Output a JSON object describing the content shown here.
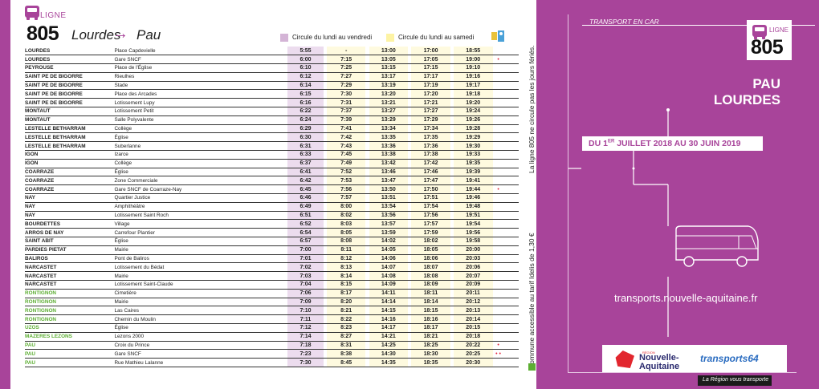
{
  "header": {
    "ligne_label": "LIGNE",
    "route_number": "805",
    "from": "Lourdes",
    "arrow": "→",
    "to": "Pau",
    "legend_friday": "Circule du lundi au vendredi",
    "legend_weekdays": "Circule du lundi au samedi",
    "colors": {
      "brand": "#a8449a",
      "friday": "#ecdcee",
      "weekdays": "#fefadf",
      "green": "#5cae32",
      "mark": "#e3243b"
    }
  },
  "timetable": {
    "rows": [
      {
        "city": "LOURDES",
        "stop": "Place Capdevielle",
        "t1": "5:55",
        "t2": "-",
        "t3": "13:00",
        "t4": "17:00",
        "t5": "18:55",
        "mark": "",
        "green": false
      },
      {
        "city": "LOURDES",
        "stop": "Gare SNCF",
        "t1": "6:00",
        "t2": "7:15",
        "t3": "13:05",
        "t4": "17:05",
        "t5": "19:00",
        "mark": "•",
        "green": false
      },
      {
        "city": "PEYROUSE",
        "stop": "Place de l'Église",
        "t1": "6:10",
        "t2": "7:25",
        "t3": "13:15",
        "t4": "17:15",
        "t5": "19:10",
        "mark": "",
        "green": false
      },
      {
        "city": "SAINT PE DE BIGORRE",
        "stop": "Rieulhes",
        "t1": "6:12",
        "t2": "7:27",
        "t3": "13:17",
        "t4": "17:17",
        "t5": "19:16",
        "mark": "",
        "green": false
      },
      {
        "city": "SAINT PE DE BIGORRE",
        "stop": "Stade",
        "t1": "6:14",
        "t2": "7:29",
        "t3": "13:19",
        "t4": "17:19",
        "t5": "19:17",
        "mark": "",
        "green": false
      },
      {
        "city": "SAINT PE DE BIGORRE",
        "stop": "Place des Arcades",
        "t1": "6:15",
        "t2": "7:30",
        "t3": "13:20",
        "t4": "17:20",
        "t5": "19:18",
        "mark": "",
        "green": false
      },
      {
        "city": "SAINT PE DE BIGORRE",
        "stop": "Lotissement Lupy",
        "t1": "6:16",
        "t2": "7:31",
        "t3": "13:21",
        "t4": "17:21",
        "t5": "19:20",
        "mark": "",
        "green": false
      },
      {
        "city": "MONTAUT",
        "stop": "Lotissement Petit",
        "t1": "6:22",
        "t2": "7:37",
        "t3": "13:27",
        "t4": "17:27",
        "t5": "19:24",
        "mark": "",
        "green": false
      },
      {
        "city": "MONTAUT",
        "stop": "Salle Polyvalente",
        "t1": "6:24",
        "t2": "7:39",
        "t3": "13:29",
        "t4": "17:29",
        "t5": "19:26",
        "mark": "",
        "green": false
      },
      {
        "city": "LESTELLE BETHARRAM",
        "stop": "Collège",
        "t1": "6:29",
        "t2": "7:41",
        "t3": "13:34",
        "t4": "17:34",
        "t5": "19:28",
        "mark": "",
        "green": false
      },
      {
        "city": "LESTELLE BETHARRAM",
        "stop": "Église",
        "t1": "6:30",
        "t2": "7:42",
        "t3": "13:35",
        "t4": "17:35",
        "t5": "19:29",
        "mark": "",
        "green": false
      },
      {
        "city": "LESTELLE BETHARRAM",
        "stop": "Suberlanne",
        "t1": "6:31",
        "t2": "7:43",
        "t3": "13:36",
        "t4": "17:36",
        "t5": "19:30",
        "mark": "",
        "green": false
      },
      {
        "city": "IGON",
        "stop": "Izarce",
        "t1": "6:33",
        "t2": "7:45",
        "t3": "13:38",
        "t4": "17:38",
        "t5": "19:33",
        "mark": "",
        "green": false
      },
      {
        "city": "IGON",
        "stop": "Collège",
        "t1": "6:37",
        "t2": "7:49",
        "t3": "13:42",
        "t4": "17:42",
        "t5": "19:35",
        "mark": "",
        "green": false
      },
      {
        "city": "COARRAZE",
        "stop": "Église",
        "t1": "6:41",
        "t2": "7:52",
        "t3": "13:46",
        "t4": "17:46",
        "t5": "19:39",
        "mark": "",
        "green": false
      },
      {
        "city": "COARRAZE",
        "stop": "Zone Commerciale",
        "t1": "6:42",
        "t2": "7:53",
        "t3": "13:47",
        "t4": "17:47",
        "t5": "19:41",
        "mark": "",
        "green": false
      },
      {
        "city": "COARRAZE",
        "stop": "Gare SNCF de Coarraze-Nay",
        "t1": "6:45",
        "t2": "7:56",
        "t3": "13:50",
        "t4": "17:50",
        "t5": "19:44",
        "mark": "•",
        "green": false
      },
      {
        "city": "NAY",
        "stop": "Quartier Justice",
        "t1": "6:46",
        "t2": "7:57",
        "t3": "13:51",
        "t4": "17:51",
        "t5": "19:46",
        "mark": "",
        "green": false
      },
      {
        "city": "NAY",
        "stop": "Amphithéâtre",
        "t1": "6:49",
        "t2": "8:00",
        "t3": "13:54",
        "t4": "17:54",
        "t5": "19:48",
        "mark": "",
        "green": false
      },
      {
        "city": "NAY",
        "stop": "Lotissement Saint Roch",
        "t1": "6:51",
        "t2": "8:02",
        "t3": "13:56",
        "t4": "17:56",
        "t5": "19:51",
        "mark": "",
        "green": false
      },
      {
        "city": "BOURDETTES",
        "stop": "Village",
        "t1": "6:52",
        "t2": "8:03",
        "t3": "13:57",
        "t4": "17:57",
        "t5": "19:54",
        "mark": "",
        "green": false
      },
      {
        "city": "ARROS DE NAY",
        "stop": "Carrefour Plantier",
        "t1": "6:54",
        "t2": "8:05",
        "t3": "13:59",
        "t4": "17:59",
        "t5": "19:56",
        "mark": "",
        "green": false
      },
      {
        "city": "SAINT ABIT",
        "stop": "Église",
        "t1": "6:57",
        "t2": "8:08",
        "t3": "14:02",
        "t4": "18:02",
        "t5": "19:58",
        "mark": "",
        "green": false
      },
      {
        "city": "PARDIES PIETAT",
        "stop": "Mairie",
        "t1": "7:00",
        "t2": "8:11",
        "t3": "14:05",
        "t4": "18:05",
        "t5": "20:00",
        "mark": "",
        "green": false
      },
      {
        "city": "BALIROS",
        "stop": "Pont de Baliros",
        "t1": "7:01",
        "t2": "8:12",
        "t3": "14:06",
        "t4": "18:06",
        "t5": "20:03",
        "mark": "",
        "green": false
      },
      {
        "city": "NARCASTET",
        "stop": "Lotissement du Bédat",
        "t1": "7:02",
        "t2": "8:13",
        "t3": "14:07",
        "t4": "18:07",
        "t5": "20:06",
        "mark": "",
        "green": false
      },
      {
        "city": "NARCASTET",
        "stop": "Mairie",
        "t1": "7:03",
        "t2": "8:14",
        "t3": "14:08",
        "t4": "18:08",
        "t5": "20:07",
        "mark": "",
        "green": false
      },
      {
        "city": "NARCASTET",
        "stop": "Lotissement Saint-Claude",
        "t1": "7:04",
        "t2": "8:15",
        "t3": "14:09",
        "t4": "18:09",
        "t5": "20:09",
        "mark": "",
        "green": false
      },
      {
        "city": "RONTIGNON",
        "stop": "Cimetière",
        "t1": "7:06",
        "t2": "8:17",
        "t3": "14:11",
        "t4": "18:11",
        "t5": "20:11",
        "mark": "",
        "green": true
      },
      {
        "city": "RONTIGNON",
        "stop": "Mairie",
        "t1": "7:09",
        "t2": "8:20",
        "t3": "14:14",
        "t4": "18:14",
        "t5": "20:12",
        "mark": "",
        "green": true
      },
      {
        "city": "RONTIGNON",
        "stop": "Las Caires",
        "t1": "7:10",
        "t2": "8:21",
        "t3": "14:15",
        "t4": "18:15",
        "t5": "20:13",
        "mark": "",
        "green": true
      },
      {
        "city": "RONTIGNON",
        "stop": "Chemin du Moulin",
        "t1": "7:11",
        "t2": "8:22",
        "t3": "14:16",
        "t4": "18:16",
        "t5": "20:14",
        "mark": "",
        "green": true
      },
      {
        "city": "UZOS",
        "stop": "Église",
        "t1": "7:12",
        "t2": "8:23",
        "t3": "14:17",
        "t4": "18:17",
        "t5": "20:15",
        "mark": "",
        "green": true
      },
      {
        "city": "MAZERES LEZONS",
        "stop": "Lezons 2000",
        "t1": "7:14",
        "t2": "8:27",
        "t3": "14:21",
        "t4": "18:21",
        "t5": "20:18",
        "mark": "",
        "green": true
      },
      {
        "city": "PAU",
        "stop": "Croix du Prince",
        "t1": "7:18",
        "t2": "8:31",
        "t3": "14:25",
        "t4": "18:25",
        "t5": "20:22",
        "mark": "•",
        "green": true
      },
      {
        "city": "PAU",
        "stop": "Gare SNCF",
        "t1": "7:23",
        "t2": "8:38",
        "t3": "14:30",
        "t4": "18:30",
        "t5": "20:25",
        "mark": "•  •",
        "green": true
      },
      {
        "city": "PAU",
        "stop": "Rue Mathieu Lalanne",
        "t1": "7:30",
        "t2": "8:45",
        "t3": "14:35",
        "t4": "18:35",
        "t5": "20:30",
        "mark": "",
        "green": true
      }
    ]
  },
  "notes": {
    "feries": "La ligne 805 ne circule pas les jours fériés.",
    "tarif": "Commune accessible au tarif Idelis de 1,30 €"
  },
  "right": {
    "transport_label": "TRANSPORT EN CAR",
    "ligne_label": "LIGNE",
    "route_number": "805",
    "dest_1": "PAU",
    "dest_2": "LOURDES",
    "date_prefix": "DU 1",
    "date_sup": "ER",
    "date_suffix": " JUILLET 2018 AU 30 JUIN 2019",
    "url": "transports.nouvelle-aquitaine.fr",
    "na_region": "RÉGION",
    "na_name_1": "Nouvelle-",
    "na_name_2": "Aquitaine",
    "t64": "transports64",
    "tagline": "La Région vous transporte"
  }
}
